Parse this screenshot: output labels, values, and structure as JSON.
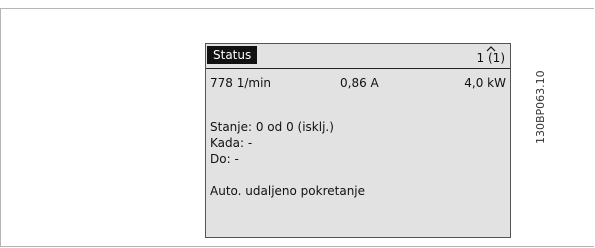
{
  "panel": {
    "status_label": "Status",
    "setup_indicator": "1 (1)",
    "readouts": [
      "778 1/min",
      "0,86 A",
      "4,0 kW"
    ],
    "state_line": "Stanje: 0 od 0 (isklj.)",
    "when_line": "Kada: -",
    "until_line": "Do: -",
    "mode_line": "Auto. udaljeno pokretanje"
  },
  "figure_code": "130BP063.10",
  "colors": {
    "panel_bg": "#e2e2e2",
    "status_tab_bg": "#111111",
    "frame": "#b5b5b5"
  }
}
